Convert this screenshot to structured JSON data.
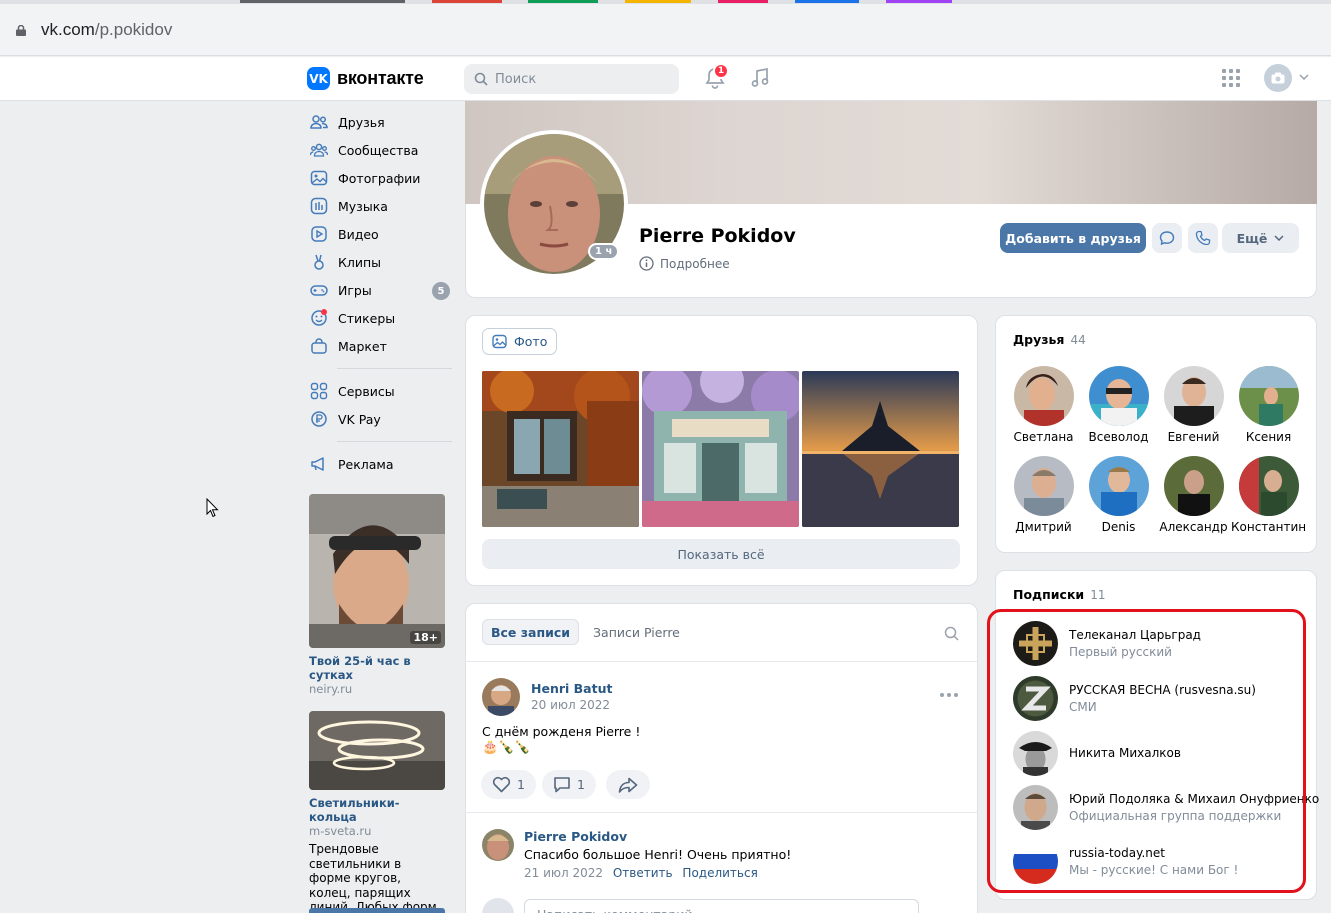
{
  "browser": {
    "url_domain": "vk.com",
    "url_path": "/p.pokidov"
  },
  "header": {
    "logo_text": "вконтакте",
    "search_placeholder": "Поиск",
    "notification_count": "1"
  },
  "nav": {
    "items": [
      {
        "label": "Друзья",
        "icon": "friends-icon"
      },
      {
        "label": "Сообщества",
        "icon": "communities-icon"
      },
      {
        "label": "Фотографии",
        "icon": "photos-icon"
      },
      {
        "label": "Музыка",
        "icon": "music-icon"
      },
      {
        "label": "Видео",
        "icon": "video-icon"
      },
      {
        "label": "Клипы",
        "icon": "clips-icon"
      },
      {
        "label": "Игры",
        "icon": "games-icon",
        "count": "5"
      },
      {
        "label": "Стикеры",
        "icon": "stickers-icon"
      },
      {
        "label": "Маркет",
        "icon": "market-icon"
      },
      {
        "label": "Сервисы",
        "icon": "services-icon"
      },
      {
        "label": "VK Pay",
        "icon": "vkpay-icon"
      },
      {
        "label": "Реклама",
        "icon": "ads-icon"
      }
    ]
  },
  "ads": [
    {
      "title": "Твой 25-й час в сутках",
      "domain": "neiry.ru",
      "badge": "18+"
    },
    {
      "title": "Светильники-кольца",
      "domain": "m-sveta.ru",
      "text": "Трендовые светильники в форме кругов, колец, парящих линий. Любых форм"
    }
  ],
  "profile": {
    "name": "Pierre Pokidov",
    "online": "1 ч",
    "details_label": "Подробнее",
    "add_friend_label": "Добавить в друзья",
    "more_label": "Ещё"
  },
  "photos": {
    "chip_label": "Фото",
    "show_all_label": "Показать всё"
  },
  "wall": {
    "tab_all": "Все записи",
    "tab_own": "Записи Pierre",
    "post": {
      "author": "Henri Batut",
      "date": "20 июл 2022",
      "text": "С днём рожденя Pierre !",
      "emoji": "🎂🍾🍾",
      "likes": "1",
      "comments": "1"
    },
    "comment": {
      "author": "Pierre Pokidov",
      "text": "Спасибо большое Henri! Очень приятно!",
      "date": "21 июл 2022",
      "reply_label": "Ответить",
      "share_label": "Поделиться"
    },
    "comment_placeholder": "Написать комментарий..."
  },
  "friends": {
    "title": "Друзья",
    "count": "44",
    "items": [
      "Светлана",
      "Всеволод",
      "Евгений",
      "Ксения",
      "Дмитрий",
      "Denis",
      "Александр",
      "Константин"
    ]
  },
  "subscriptions": {
    "title": "Подписки",
    "count": "11",
    "items": [
      {
        "name": "Телеканал Царьград",
        "desc": "Первый русский"
      },
      {
        "name": "РУССКАЯ ВЕСНА (rusvesna.su)",
        "desc": "СМИ"
      },
      {
        "name": "Никита Михалков",
        "desc": ""
      },
      {
        "name": "Юрий Подоляка & Михаил Онуфриенко",
        "desc": "Официальная группа поддержки"
      },
      {
        "name": "russia-today.net",
        "desc": "Мы - русские! С нами Бог !"
      }
    ]
  },
  "colors": {
    "accent": "#4a76a8",
    "link": "#2a5885",
    "highlight": "#e3111b"
  }
}
